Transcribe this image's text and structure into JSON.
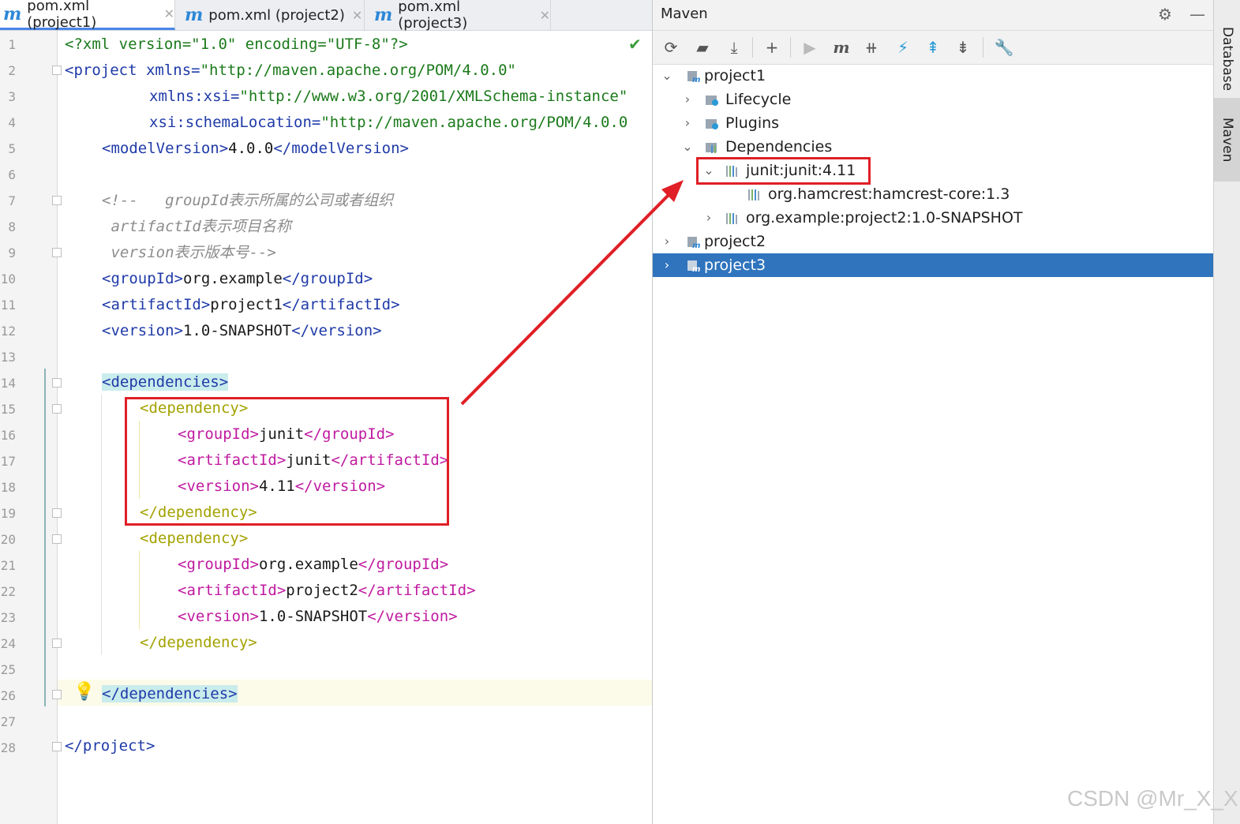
{
  "tabs": [
    {
      "label": "pom.xml (project1)",
      "active": true
    },
    {
      "label": "pom.xml (project2)",
      "active": false
    },
    {
      "label": "pom.xml (project3)",
      "active": false
    }
  ],
  "line_numbers": [
    "1",
    "2",
    "3",
    "4",
    "5",
    "6",
    "7",
    "8",
    "9",
    "10",
    "11",
    "12",
    "13",
    "14",
    "15",
    "16",
    "17",
    "18",
    "19",
    "20",
    "21",
    "22",
    "23",
    "24",
    "25",
    "26",
    "27",
    "28"
  ],
  "code": {
    "l1": "<?xml version=\"1.0\" encoding=\"UTF-8\"?>",
    "l2a": "<project ",
    "l2b": "xmlns=",
    "l2c": "\"http://maven.apache.org/POM/4.0.0\"",
    "l3a": "xmlns:xsi=",
    "l3b": "\"http://www.w3.org/2001/XMLSchema-instance\"",
    "l4a": "xsi:schemaLocation=",
    "l4b": "\"http://maven.apache.org/POM/4.0.0",
    "l5a": "<modelVersion>",
    "l5b": "4.0.0",
    "l5c": "</modelVersion>",
    "l7": "<!--   groupId表示所属的公司或者组织",
    "l8": " artifactId表示项目名称",
    "l9": " version表示版本号-->",
    "l10a": "<groupId>",
    "l10b": "org.example",
    "l10c": "</groupId>",
    "l11a": "<artifactId>",
    "l11b": "project1",
    "l11c": "</artifactId>",
    "l12a": "<version>",
    "l12b": "1.0-SNAPSHOT",
    "l12c": "</version>",
    "l14": "<dependencies>",
    "l15": "<dependency>",
    "l16a": "<groupId>",
    "l16b": "junit",
    "l16c": "</groupId>",
    "l17a": "<artifactId>",
    "l17b": "junit",
    "l17c": "</artifactId>",
    "l18a": "<version>",
    "l18b": "4.11",
    "l18c": "</version>",
    "l19": "</dependency>",
    "l20": "<dependency>",
    "l21a": "<groupId>",
    "l21b": "org.example",
    "l21c": "</groupId>",
    "l22a": "<artifactId>",
    "l22b": "project2",
    "l22c": "</artifactId>",
    "l23a": "<version>",
    "l23b": "1.0-SNAPSHOT",
    "l23c": "</version>",
    "l24": "</dependency>",
    "l26": "</dependencies>",
    "l28": "</project>"
  },
  "maven": {
    "title": "Maven",
    "toolbar_icons": [
      "reload-icon",
      "add-folder-icon",
      "download-icon",
      "plus-icon",
      "run-icon",
      "maven-goal-icon",
      "skip-tests-icon",
      "offline-icon",
      "expand-all-icon",
      "collapse-all-icon",
      "settings-wrench-icon"
    ],
    "tree": [
      {
        "label": "project1",
        "expanded": true
      },
      {
        "label": "Lifecycle"
      },
      {
        "label": "Plugins"
      },
      {
        "label": "Dependencies",
        "expanded": true
      },
      {
        "label": "junit:junit:4.11",
        "expanded": true
      },
      {
        "label": "org.hamcrest:hamcrest-core:1.3"
      },
      {
        "label": "org.example:project2:1.0-SNAPSHOT"
      },
      {
        "label": "project2"
      },
      {
        "label": "project3",
        "selected": true
      }
    ]
  },
  "right_strip": {
    "database": "Database",
    "maven": "Maven"
  },
  "watermark": "CSDN @Mr_X_X",
  "colors": {
    "selection": "#2f74bd",
    "annotation": "#e01f26",
    "tag": "#1f3aa8"
  }
}
